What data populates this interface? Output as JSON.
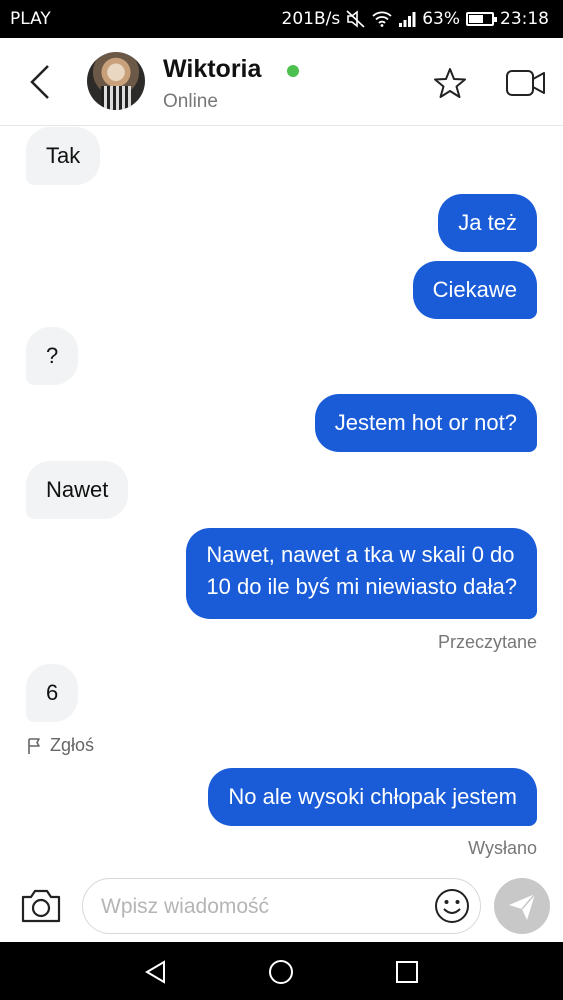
{
  "status_bar": {
    "carrier": "PLAY",
    "network_speed": "201B/s",
    "battery_percent": "63%",
    "battery_level": 0.63,
    "time": "23:18"
  },
  "header": {
    "contact_name": "Wiktoria",
    "status": "Online",
    "online_color": "#4cc14f"
  },
  "messages": [
    {
      "id": "m1",
      "direction": "incoming",
      "text": "Tak"
    },
    {
      "id": "m2",
      "direction": "outgoing",
      "text": "Ja też"
    },
    {
      "id": "m3",
      "direction": "outgoing",
      "text": "Ciekawe"
    },
    {
      "id": "m4",
      "direction": "incoming",
      "text": "?"
    },
    {
      "id": "m5",
      "direction": "outgoing",
      "text": "Jestem hot or not?"
    },
    {
      "id": "m6",
      "direction": "incoming",
      "text": "Nawet"
    },
    {
      "id": "m7",
      "direction": "outgoing",
      "lines": [
        "Nawet, nawet a tka w skali 0 do",
        "10 do ile byś mi niewiasto dała?"
      ]
    },
    {
      "id": "m8",
      "direction": "incoming",
      "text": "6"
    },
    {
      "id": "m9",
      "direction": "outgoing",
      "text": "No ale wysoki chłopak jestem"
    }
  ],
  "read_receipt": "Przeczytane",
  "report_label": "Zgłoś",
  "sent_receipt": "Wysłano",
  "composer": {
    "placeholder": "Wpisz wiadomość",
    "value": ""
  },
  "colors": {
    "outgoing_bubble": "#1a5cd8",
    "incoming_bubble": "#f2f3f4",
    "send_button": "#c8c8c8"
  },
  "icons": {
    "back": "chevron-left-icon",
    "favorite": "star-icon",
    "video_call": "video-camera-icon",
    "camera": "camera-icon",
    "emoji": "smiley-icon",
    "send": "paper-plane-icon",
    "report": "flag-icon",
    "nav_back": "triangle-back-icon",
    "nav_home": "circle-home-icon",
    "nav_recent": "square-recents-icon"
  }
}
